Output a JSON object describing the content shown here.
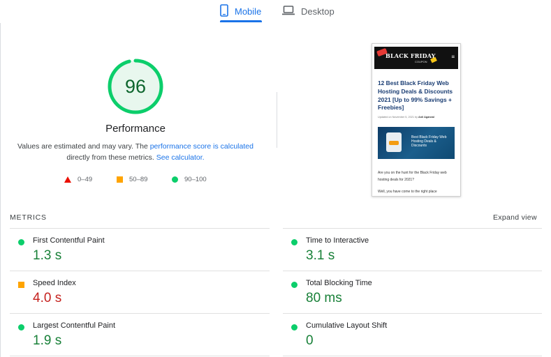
{
  "tabs": {
    "mobile_label": "Mobile",
    "desktop_label": "Desktop"
  },
  "score": {
    "value": "96",
    "fraction": 0.96,
    "label": "Performance",
    "color": "#0cce6b"
  },
  "note": {
    "prefix": "Values are estimated and may vary. The ",
    "link1": "performance score is calculated",
    "middle": "directly from these metrics. ",
    "link2": "See calculator."
  },
  "legend": {
    "red": "0–49",
    "orange": "50–89",
    "green": "90–100"
  },
  "thumbnail": {
    "logo_text": "BLACK FRIDAY",
    "logo_sub": "COUPON",
    "title": "12 Best Black Friday Web Hosting Deals & Discounts 2021 [Up to 99% Savings + Freebies]",
    "meta_prefix": "Updated on November 5, 2021 by ",
    "meta_author": "Anil Agarwal",
    "banner_text": "Best Black Friday Web Hosting Deals & Discounts",
    "body1": "Are you on the hunt for the Black Friday web hosting deals for 2021?",
    "body2": "Well, you have come to the right place"
  },
  "metrics": {
    "title": "METRICS",
    "expand_label": "Expand view",
    "items": [
      {
        "name": "First Contentful Paint",
        "value": "1.3 s"
      },
      {
        "name": "Time to Interactive",
        "value": "3.1 s"
      },
      {
        "name": "Speed Index",
        "value": "4.0 s"
      },
      {
        "name": "Total Blocking Time",
        "value": "80 ms"
      },
      {
        "name": "Largest Contentful Paint",
        "value": "1.9 s"
      },
      {
        "name": "Cumulative Layout Shift",
        "value": "0"
      }
    ]
  }
}
